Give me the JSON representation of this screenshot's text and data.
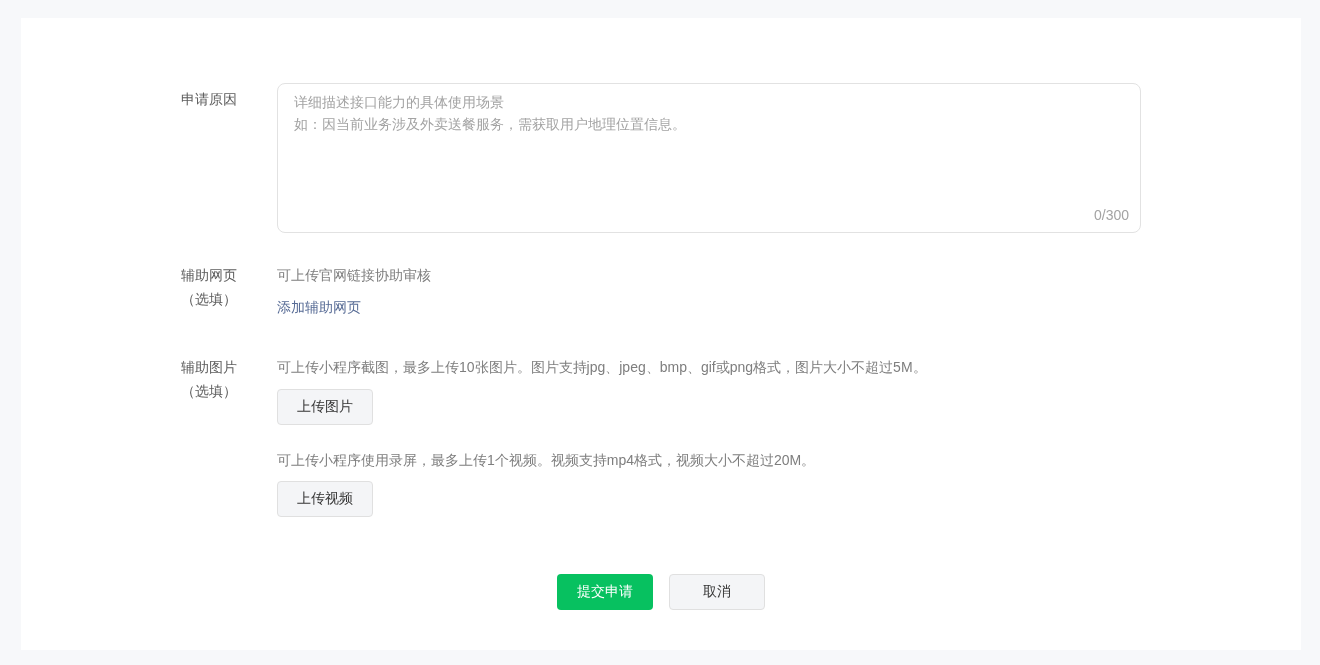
{
  "form": {
    "fields": [
      {
        "kind": "textarea",
        "label": "申请原因",
        "placeholder": [
          "详细描述接口能力的具体使用场景",
          "如：因当前业务涉及外卖送餐服务，需获取用户地理位置信息。"
        ],
        "counter": "0/300"
      },
      {
        "kind": "link",
        "label": "辅助网页",
        "sublabel": "（选填）",
        "hint": "可上传官网链接协助审核",
        "link": "添加辅助网页"
      },
      {
        "kind": "upload",
        "label": "辅助图片",
        "sublabel": "（选填）",
        "groups": [
          {
            "hint": "可上传小程序截图，最多上传10张图片。图片支持jpg、jpeg、bmp、gif或png格式，图片大小不超过5M。",
            "button": "上传图片"
          },
          {
            "hint": "可上传小程序使用录屏，最多上传1个视频。视频支持mp4格式，视频大小不超过20M。",
            "button": "上传视频"
          }
        ]
      }
    ]
  },
  "actions": [
    {
      "kind": "primary",
      "label": "提交申请"
    },
    {
      "kind": "default",
      "label": "取消"
    }
  ]
}
